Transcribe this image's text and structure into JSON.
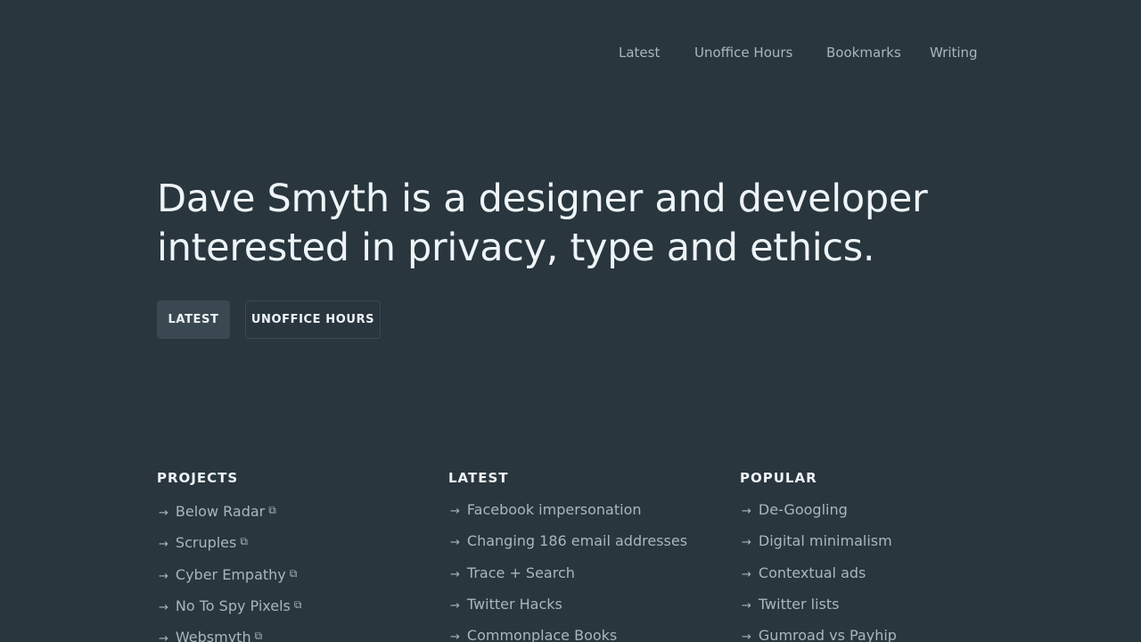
{
  "nav": {
    "items": [
      "Latest",
      "Unoffice Hours",
      "Bookmarks",
      "Writing"
    ]
  },
  "hero": {
    "line1": "Dave Smyth is a designer and developer",
    "line2": "interested in privacy, type and ethics."
  },
  "buttons": {
    "latest": "LATEST",
    "unoffice_hours": "UNOFFICE HOURS"
  },
  "columns": {
    "projects": {
      "heading": "PROJECTS",
      "items": [
        "Below Radar",
        "Scruples",
        "Cyber Empathy",
        "No To Spy Pixels",
        "Websmyth"
      ]
    },
    "latest": {
      "heading": "LATEST",
      "items": [
        "Facebook impersonation",
        "Changing 186 email addresses",
        "Trace + Search",
        "Twitter Hacks",
        "Commonplace Books"
      ]
    },
    "popular": {
      "heading": "POPULAR",
      "items": [
        "De-Googling",
        "Digital minimalism",
        "Contextual ads",
        "Twitter lists",
        "Gumroad vs Payhip"
      ]
    }
  },
  "icons": {
    "list_arrow": "right-arrow-icon",
    "external": "external-link-icon"
  }
}
